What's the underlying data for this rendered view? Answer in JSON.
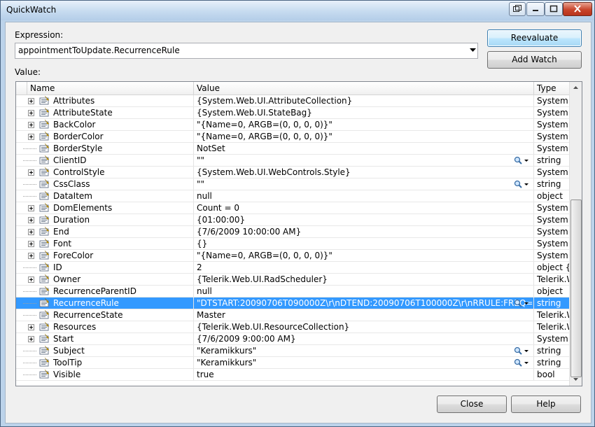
{
  "window": {
    "title": "QuickWatch"
  },
  "expression": {
    "label": "Expression:",
    "value": "appointmentToUpdate.RecurrenceRule"
  },
  "buttons": {
    "reevaluate": "Reevaluate",
    "add_watch": "Add Watch",
    "close": "Close",
    "help": "Help"
  },
  "value_label": "Value:",
  "grid": {
    "columns": [
      "Name",
      "Value",
      "Type"
    ],
    "rows": [
      {
        "name": "Attributes",
        "value": "{System.Web.UI.AttributeCollection}",
        "type": "System.W",
        "expandable": true,
        "magnifier": false
      },
      {
        "name": "AttributeState",
        "value": "{System.Web.UI.StateBag}",
        "type": "System.W",
        "expandable": true,
        "magnifier": false
      },
      {
        "name": "BackColor",
        "value": "\"{Name=0, ARGB=(0, 0, 0, 0)}\"",
        "type": "System.D",
        "expandable": true,
        "magnifier": false
      },
      {
        "name": "BorderColor",
        "value": "\"{Name=0, ARGB=(0, 0, 0, 0)}\"",
        "type": "System.D",
        "expandable": true,
        "magnifier": false
      },
      {
        "name": "BorderStyle",
        "value": "NotSet",
        "type": "System.W",
        "expandable": false,
        "magnifier": false
      },
      {
        "name": "ClientID",
        "value": "\"\"",
        "type": "string",
        "expandable": false,
        "magnifier": true
      },
      {
        "name": "ControlStyle",
        "value": "{System.Web.UI.WebControls.Style}",
        "type": "System.W",
        "expandable": true,
        "magnifier": false
      },
      {
        "name": "CssClass",
        "value": "\"\"",
        "type": "string",
        "expandable": false,
        "magnifier": true
      },
      {
        "name": "DataItem",
        "value": "null",
        "type": "object",
        "expandable": false,
        "magnifier": false
      },
      {
        "name": "DomElements",
        "value": "Count = 0",
        "type": "System.C",
        "expandable": true,
        "magnifier": false
      },
      {
        "name": "Duration",
        "value": "{01:00:00}",
        "type": "System.T",
        "expandable": true,
        "magnifier": false
      },
      {
        "name": "End",
        "value": "{7/6/2009 10:00:00 AM}",
        "type": "System.D",
        "expandable": true,
        "magnifier": false
      },
      {
        "name": "Font",
        "value": "{}",
        "type": "System.W",
        "expandable": true,
        "magnifier": false
      },
      {
        "name": "ForeColor",
        "value": "\"{Name=0, ARGB=(0, 0, 0, 0)}\"",
        "type": "System.D",
        "expandable": true,
        "magnifier": false
      },
      {
        "name": "ID",
        "value": "2",
        "type": "object {in",
        "expandable": false,
        "magnifier": false
      },
      {
        "name": "Owner",
        "value": "{Telerik.Web.UI.RadScheduler}",
        "type": "Telerik.W",
        "expandable": true,
        "magnifier": false
      },
      {
        "name": "RecurrenceParentID",
        "value": "null",
        "type": "object",
        "expandable": false,
        "magnifier": false
      },
      {
        "name": "RecurrenceRule",
        "value": "\"DTSTART:20090706T090000Z\\r\\nDTEND:20090706T100000Z\\r\\nRRULE:FREQ=DAILY;INTERV",
        "type": "string",
        "expandable": false,
        "magnifier": true,
        "selected": true
      },
      {
        "name": "RecurrenceState",
        "value": "Master",
        "type": "Telerik.W",
        "expandable": false,
        "magnifier": false
      },
      {
        "name": "Resources",
        "value": "{Telerik.Web.UI.ResourceCollection}",
        "type": "Telerik.W",
        "expandable": true,
        "magnifier": false
      },
      {
        "name": "Start",
        "value": "{7/6/2009 9:00:00 AM}",
        "type": "System.D",
        "expandable": true,
        "magnifier": false
      },
      {
        "name": "Subject",
        "value": "\"Keramikkurs\"",
        "type": "string",
        "expandable": false,
        "magnifier": true
      },
      {
        "name": "ToolTip",
        "value": "\"Keramikkurs\"",
        "type": "string",
        "expandable": false,
        "magnifier": true
      },
      {
        "name": "Visible",
        "value": "true",
        "type": "bool",
        "expandable": false,
        "magnifier": false
      }
    ]
  },
  "colors": {
    "selection": "#3399ff",
    "title_bar": "#c6dbf0"
  },
  "icons": [
    "restore-icon",
    "minimize-icon",
    "maximize-icon",
    "close-icon",
    "property-icon",
    "magnifier-icon",
    "dropdown-arrow-icon"
  ]
}
